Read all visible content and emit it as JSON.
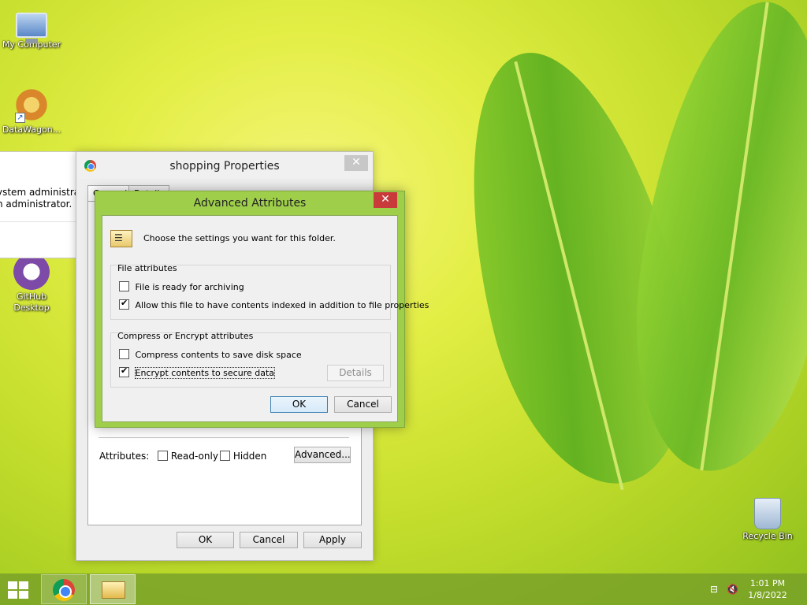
{
  "desktop": {
    "icons": [
      {
        "label": "My Computer",
        "icon": "computer-icon"
      },
      {
        "label": "DataWagon...",
        "icon": "datawagon-icon"
      },
      {
        "label": "GitHub Desktop",
        "icon": "github-icon"
      },
      {
        "label": "Recycle Bin",
        "icon": "recycle-bin-icon"
      }
    ],
    "background_window": {
      "line1": "ystem administrato",
      "line2": "n administrator."
    }
  },
  "properties": {
    "title": "shopping Properties",
    "tabs": [
      "General",
      "Details"
    ],
    "attributes_label": "Attributes:",
    "readonly_label": "Read-only",
    "hidden_label": "Hidden",
    "advanced_button": "Advanced...",
    "ok": "OK",
    "cancel": "Cancel",
    "apply": "Apply"
  },
  "advanced": {
    "title": "Advanced Attributes",
    "intro": "Choose the settings you want for this folder.",
    "file_attributes_label": "File attributes",
    "archiving_label": "File is ready for archiving",
    "archiving_checked": false,
    "indexing_label": "Allow this file to have contents indexed in addition to file properties",
    "indexing_checked": true,
    "compress_encrypt_label": "Compress or Encrypt attributes",
    "compress_label": "Compress contents to save disk space",
    "compress_checked": false,
    "encrypt_label": "Encrypt contents to secure data",
    "encrypt_checked": true,
    "details_button": "Details",
    "ok": "OK",
    "cancel": "Cancel"
  },
  "taskbar": {
    "time": "1:01 PM",
    "date": "1/8/2022"
  },
  "colors": {
    "desktop_accent": "#c7df2e",
    "dialog_frame": "#9fcf4a",
    "close_red": "#c93a3a"
  }
}
